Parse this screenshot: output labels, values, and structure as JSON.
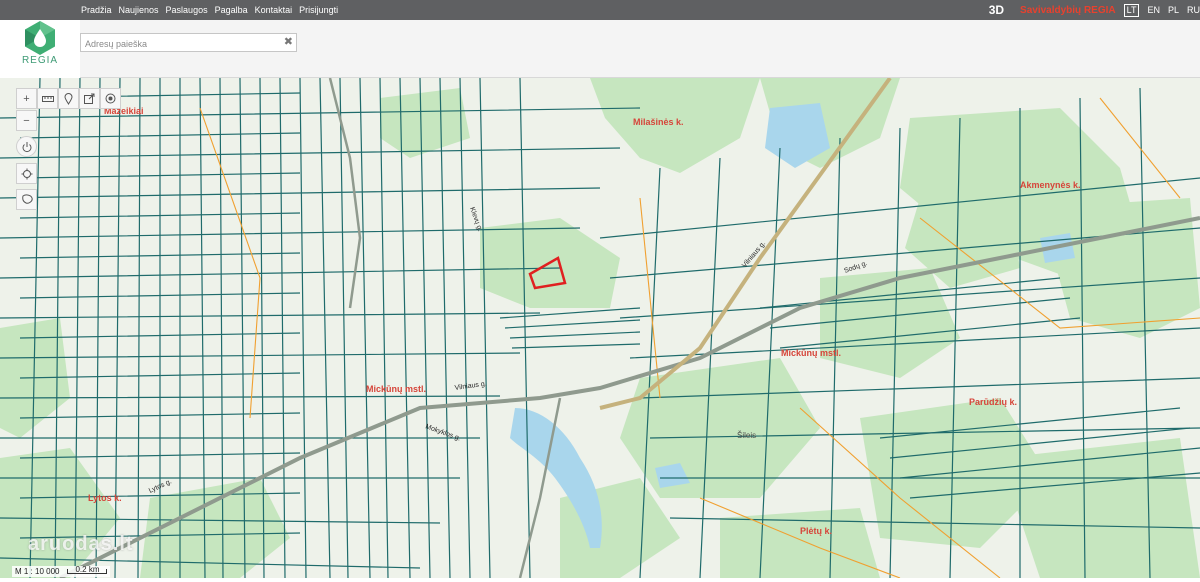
{
  "nav": {
    "items": [
      "Pradžia",
      "Naujienos",
      "Paslaugos",
      "Pagalba",
      "Kontaktai",
      "Prisijungti"
    ],
    "three_d": "3D",
    "brand": "Savivaldybių REGIA",
    "languages": [
      "LT",
      "EN",
      "PL",
      "RU"
    ],
    "active_language": "LT"
  },
  "logo": {
    "text": "REGIA"
  },
  "search": {
    "placeholder": "Adresų paieška",
    "value": ""
  },
  "map": {
    "place_labels": [
      "Mažeikiai",
      "Milašinės k.",
      "Akmenynės k.",
      "Mickūnų mstl.",
      "Mickūnų mstl.",
      "Parūdžių k.",
      "Lytos k.",
      "Plėtų k.",
      "Šileis"
    ],
    "street_labels": [
      "Vilniaus g.",
      "Vilniaus g.",
      "Lytos g.",
      "Mokyklos g.",
      "Klevų g.",
      "Sodų g."
    ],
    "colors": {
      "parcel": "#1f6b6b",
      "boundary_orange": "#f0a030",
      "label_red": "#d6453a",
      "forest": "#c5e5bd",
      "water": "#a9d6ec",
      "highlight": "#e02020"
    }
  },
  "tools": {
    "zoom_in": "+",
    "zoom_out": "−"
  },
  "watermark": "aruodas.lt",
  "scale": {
    "ratio": "M 1 : 10 000",
    "distance": "0.2 km"
  }
}
